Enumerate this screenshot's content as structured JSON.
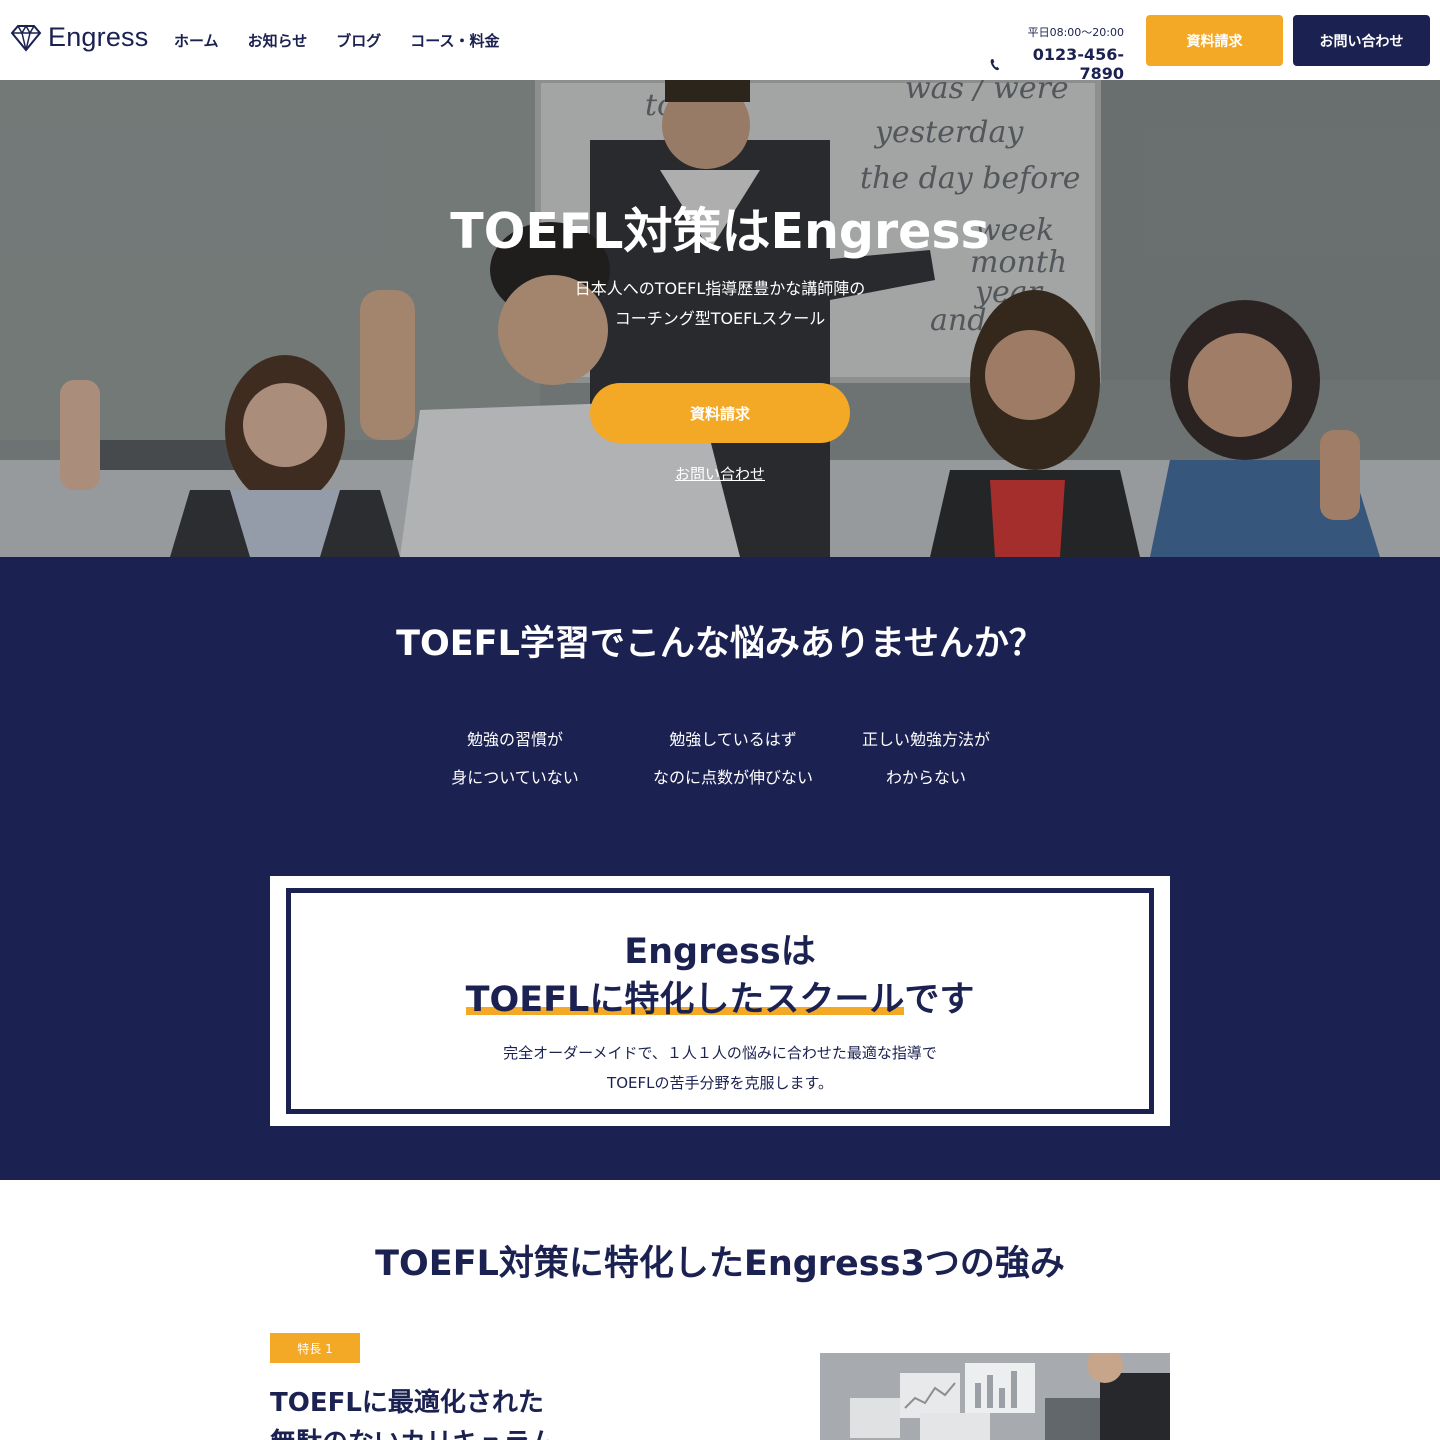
{
  "header": {
    "logo_text": "Engress",
    "nav": [
      "ホーム",
      "お知らせ",
      "ブログ",
      "コース・料金"
    ],
    "hours": "平日08:00〜20:00",
    "phone": "0123-456-7890",
    "doc_button": "資料請求",
    "contact_button": "お問い合わせ"
  },
  "hero": {
    "title": "TOEFL対策はEngress",
    "subtitle_line1": "日本人へのTOEFL指導歴豊かな講師陣の",
    "subtitle_line2": "コーチング型TOEFLスクール",
    "cta_button": "資料請求",
    "contact_link": "お問い合わせ",
    "board_text": [
      "to be",
      "was / were",
      "yesterday",
      "the day before",
      "week",
      "month",
      "year",
      "and"
    ]
  },
  "problems": {
    "title": "TOEFL学習でこんな悩みありませんか？",
    "items": [
      {
        "line1": "勉強の習慣が",
        "line2": "身についていない"
      },
      {
        "line1": "勉強しているはず",
        "line2": "なのに点数が伸びない"
      },
      {
        "line1": "正しい勉強方法が",
        "line2": "わからない"
      }
    ]
  },
  "feature_box": {
    "line1": "Engressは",
    "line2_highlight": "TOEFLに特化したスクール",
    "line2_rest": "です",
    "desc_line1": "完全オーダーメイドで、１人１人の悩みに合わせた最適な指導で",
    "desc_line2": "TOEFLの苦手分野を克服します。"
  },
  "strengths": {
    "title": "TOEFL対策に特化したEngress3つの強み",
    "badge": "特長 1",
    "heading_line1": "TOEFLに最適化された",
    "heading_line2": "無駄のないカリキュラム"
  },
  "colors": {
    "navy": "#1b2150",
    "orange": "#f3a826",
    "white": "#ffffff"
  }
}
